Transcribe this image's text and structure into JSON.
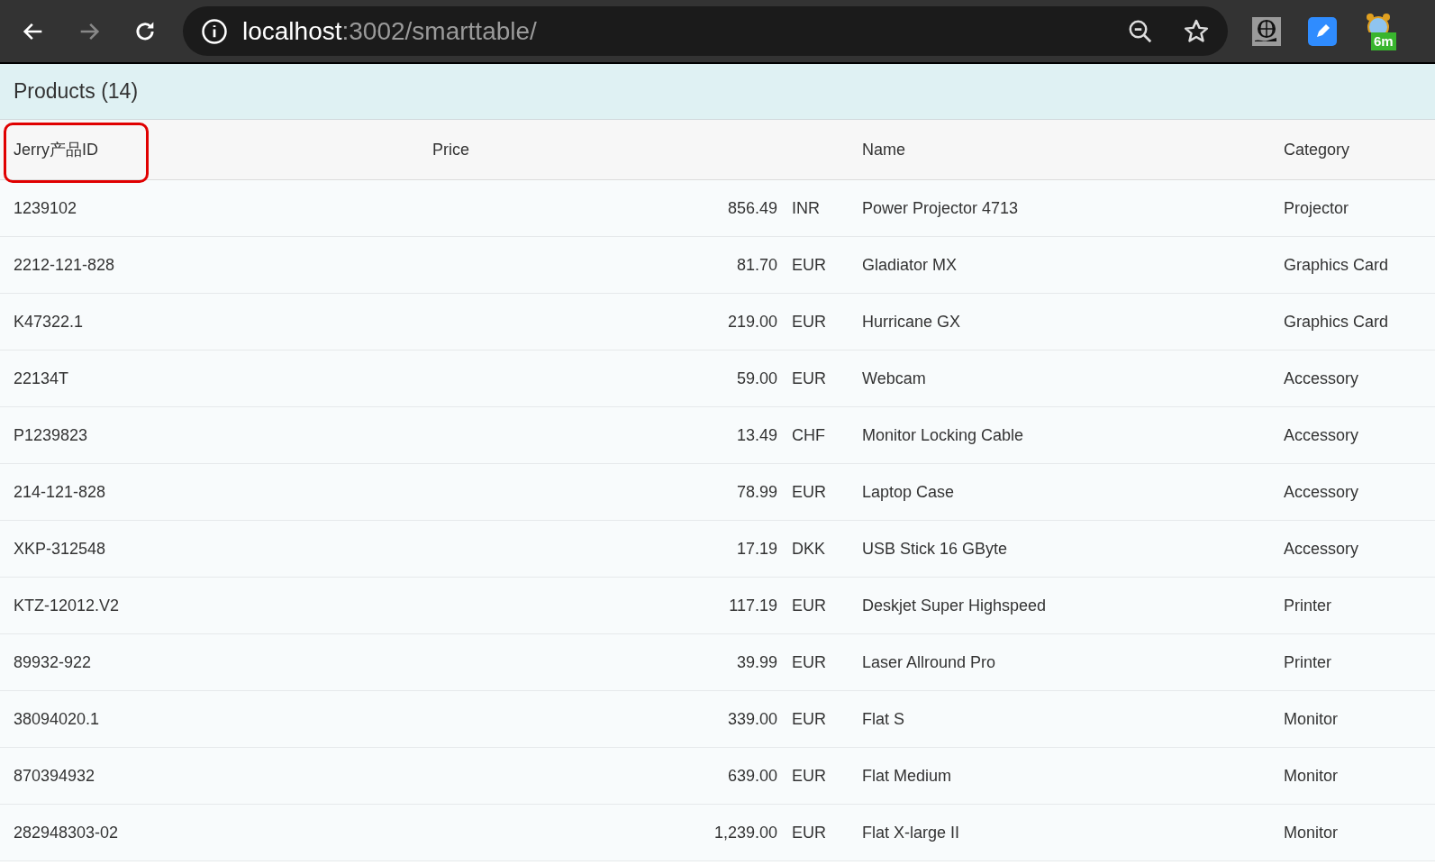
{
  "browser": {
    "url_host": "localhost",
    "url_path": ":3002/smarttable/",
    "extension_badge": "6m"
  },
  "title": "Products (14)",
  "table": {
    "columns": [
      "Jerry产品ID",
      "Price",
      "Name",
      "Category"
    ],
    "rows": [
      {
        "id": "1239102",
        "price": "856.49",
        "currency": "INR",
        "name": "Power Projector 4713",
        "category": "Projector"
      },
      {
        "id": "2212-121-828",
        "price": "81.70",
        "currency": "EUR",
        "name": "Gladiator MX",
        "category": "Graphics Card"
      },
      {
        "id": "K47322.1",
        "price": "219.00",
        "currency": "EUR",
        "name": "Hurricane GX",
        "category": "Graphics Card"
      },
      {
        "id": "22134T",
        "price": "59.00",
        "currency": "EUR",
        "name": "Webcam",
        "category": "Accessory"
      },
      {
        "id": "P1239823",
        "price": "13.49",
        "currency": "CHF",
        "name": "Monitor Locking Cable",
        "category": "Accessory"
      },
      {
        "id": "214-121-828",
        "price": "78.99",
        "currency": "EUR",
        "name": "Laptop Case",
        "category": "Accessory"
      },
      {
        "id": "XKP-312548",
        "price": "17.19",
        "currency": "DKK",
        "name": "USB Stick 16 GByte",
        "category": "Accessory"
      },
      {
        "id": "KTZ-12012.V2",
        "price": "117.19",
        "currency": "EUR",
        "name": "Deskjet Super Highspeed",
        "category": "Printer"
      },
      {
        "id": "89932-922",
        "price": "39.99",
        "currency": "EUR",
        "name": "Laser Allround Pro",
        "category": "Printer"
      },
      {
        "id": "38094020.1",
        "price": "339.00",
        "currency": "EUR",
        "name": "Flat S",
        "category": "Monitor"
      },
      {
        "id": "870394932",
        "price": "639.00",
        "currency": "EUR",
        "name": "Flat Medium",
        "category": "Monitor"
      },
      {
        "id": "282948303-02",
        "price": "1,239.00",
        "currency": "EUR",
        "name": "Flat X-large II",
        "category": "Monitor"
      }
    ]
  }
}
